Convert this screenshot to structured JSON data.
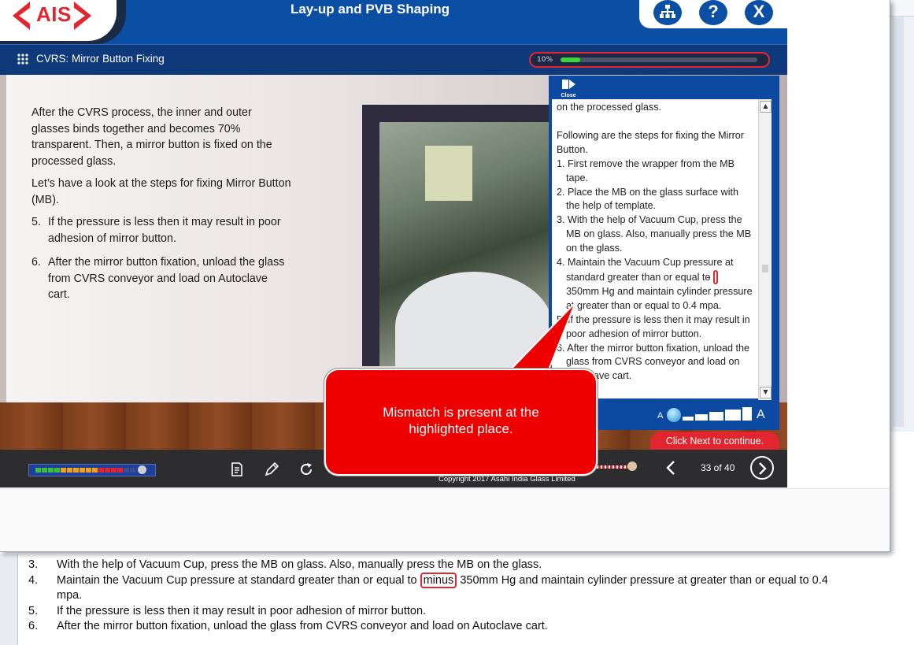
{
  "app": {
    "logo": "AIS",
    "course_title": "Lay-up and PVB Shaping",
    "module_title": "CVRS: Mirror Button Fixing",
    "progress_label": "10%",
    "progress_value": 0.1,
    "header_buttons": [
      {
        "name": "sitemap-icon",
        "glyph": "⊞"
      },
      {
        "name": "help-icon",
        "glyph": "?"
      },
      {
        "name": "exit-icon",
        "glyph": "X"
      }
    ]
  },
  "slide": {
    "intro": "After the CVRS process, the inner and outer glasses binds together and becomes 70% transparent. Then, a mirror button is fixed on the processed glass.",
    "lead": "Let’s have a look at the steps for fixing Mirror Button (MB).",
    "steps": [
      {
        "n": "5.",
        "text": "If the pressure is less then it may result in poor adhesion of mirror button."
      },
      {
        "n": "6.",
        "text": "After the mirror button fixation, unload the glass from CVRS conveyor and load on Autoclave cart."
      }
    ]
  },
  "transcript": {
    "close_label": "Close",
    "line_top": "on the processed glass.",
    "heading": "Following are the steps for fixing the Mirror Button.",
    "items": [
      "1. First remove the wrapper from the MB tape.",
      "2. Place the MB on the glass surface with the help of template.",
      "3. With the help of Vacuum Cup, press the MB on glass. Also, manually press the MB on the glass."
    ],
    "item4_pre": "4. Maintain the Vacuum Cup pressure at standard greater than or equal to",
    "item4_mark": "-",
    "item4_post": "350mm Hg and maintain cylinder pressure at greater than or equal to 0.4 mpa.",
    "items_after": [
      "5. If the pressure is less then it may result in poor adhesion of mirror button.",
      "6. After the mirror button fixation, unload the glass from CVRS conveyor and load on Autoclave cart."
    ],
    "font_small": "A",
    "font_big": "A",
    "font_level": 1
  },
  "player": {
    "next_hint": "Click Next to continue.",
    "page_count": "33 of 40",
    "copyright": "Copyright 2017 Asahi India Glass Limited",
    "audio_level": 0.85
  },
  "callout": {
    "text": "Mismatch is present at the highlighted place."
  },
  "document": {
    "lines": [
      {
        "n": "3.",
        "text": "With the help of Vacuum Cup, press the MB on glass. Also, manually press the MB on the glass."
      },
      {
        "n": "4.",
        "pre": "Maintain the Vacuum Cup pressure at standard greater than or equal to",
        "mark": "minus",
        "post": "350mm Hg and maintain cylinder pressure at greater than or equal to 0.4"
      },
      {
        "n": "",
        "text": "mpa."
      },
      {
        "n": "5.",
        "text": "If the pressure is less then it may result in poor adhesion of mirror button."
      },
      {
        "n": "6.",
        "text": "After the mirror button fixation, unload the glass from CVRS conveyor and load on Autoclave cart."
      }
    ]
  },
  "colors": {
    "brand_blue": "#0b4fa4",
    "accent_red": "#e2262f",
    "callout_red": "#ee0000",
    "progress_green": "#3cd53a"
  }
}
